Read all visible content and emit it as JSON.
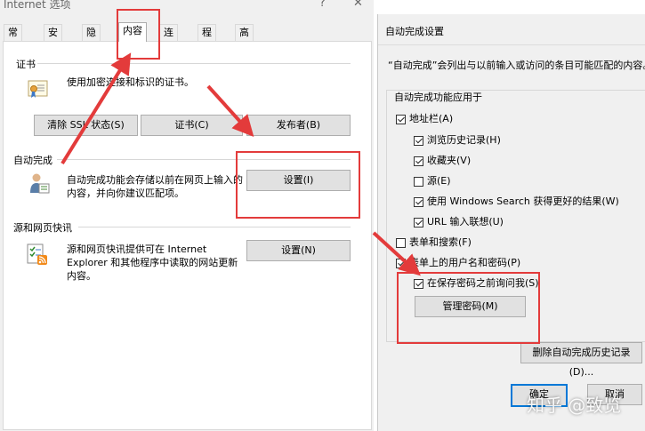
{
  "window1": {
    "title": "Internet 选项",
    "help_glyph": "?",
    "close_glyph": "✕",
    "tabs": [
      "常规",
      "安全",
      "隐私",
      "内容",
      "连接",
      "程序",
      "高级"
    ],
    "active_tab": "内容",
    "certificates": {
      "heading": "证书",
      "description": "使用加密连接和标识的证书。",
      "buttons": [
        "清除 SSL 状态(S)",
        "证书(C)",
        "发布者(B)"
      ]
    },
    "autocomplete": {
      "heading": "自动完成",
      "description_line1": "自动完成功能会存储以前在网页上输入的",
      "description_line2": "内容，并向你建议匹配项。",
      "settings_button": "设置(I)"
    },
    "feeds": {
      "heading": "源和网页快讯",
      "description_line1": "源和网页快讯提供可在 Internet",
      "description_line2": "Explorer 和其他程序中读取的网站更新",
      "description_line3": "内容。",
      "settings_button": "设置(N)"
    }
  },
  "window2": {
    "title": "自动完成设置",
    "intro": "“自动完成”会列出与以前输入或访问的条目可能匹配的内容。",
    "group_label": "自动完成功能应用于",
    "options": {
      "address_bar": {
        "label": "地址栏(A)",
        "checked": true
      },
      "browsing_history": {
        "label": "浏览历史记录(H)",
        "checked": true
      },
      "favorites": {
        "label": "收藏夹(V)",
        "checked": true
      },
      "feeds": {
        "label": "源(E)",
        "checked": false
      },
      "windows_search": {
        "label": "使用 Windows Search 获得更好的结果(W)",
        "checked": true
      },
      "url_suggestions": {
        "label": "URL 输入联想(U)",
        "checked": true
      },
      "forms": {
        "label": "表单和搜索(F)",
        "checked": false
      },
      "usernames_passwords": {
        "label": "表单上的用户名和密码(P)",
        "checked": true
      },
      "ask_before_save": {
        "label": "在保存密码之前询问我(S)",
        "checked": true
      }
    },
    "manage_passwords_button": "管理密码(M)",
    "delete_history_button": "删除自动完成历史记录(D)...",
    "ok_button": "确定",
    "cancel_button": "取消"
  },
  "watermark": "知乎 @致览",
  "colors": {
    "annotation_red": "#e33b3b",
    "window_bg": "#f0f0f0",
    "button_bg": "#e1e1e1",
    "focus_blue": "#0078d7"
  }
}
